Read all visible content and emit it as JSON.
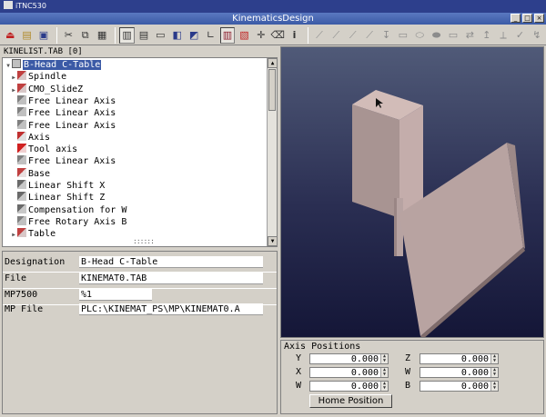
{
  "os_bar": {
    "title": "iTNC530"
  },
  "window": {
    "title": "KinematicsDesign"
  },
  "tree": {
    "header": "KINELIST.TAB   [0]",
    "items": [
      {
        "label": "B-Head C-Table",
        "expand": "▼",
        "icon": "table-root-icon",
        "selected": true
      },
      {
        "label": "Spindle",
        "expand": "▶",
        "icon": "component-icon"
      },
      {
        "label": "CMO_SlideZ",
        "expand": "▶",
        "icon": "component-icon"
      },
      {
        "label": "Free Linear Axis",
        "expand": "",
        "icon": "linear-axis-icon"
      },
      {
        "label": "Free Linear Axis",
        "expand": "",
        "icon": "linear-axis-icon"
      },
      {
        "label": "Free Linear Axis",
        "expand": "",
        "icon": "linear-axis-icon"
      },
      {
        "label": "Axis",
        "expand": "",
        "icon": "axis-icon"
      },
      {
        "label": "Tool axis",
        "expand": "",
        "icon": "tool-axis-icon"
      },
      {
        "label": "Free Linear Axis",
        "expand": "",
        "icon": "linear-axis-icon"
      },
      {
        "label": "Base",
        "expand": "",
        "icon": "base-icon"
      },
      {
        "label": "Linear Shift X",
        "expand": "",
        "icon": "shift-icon"
      },
      {
        "label": "Linear Shift Z",
        "expand": "",
        "icon": "shift-icon"
      },
      {
        "label": "Compensation for W",
        "expand": "",
        "icon": "shift-icon"
      },
      {
        "label": "Free Rotary Axis B",
        "expand": "",
        "icon": "linear-axis-icon"
      },
      {
        "label": "Table",
        "expand": "▶",
        "icon": "component-icon"
      },
      {
        "label": "",
        "expand": "",
        "icon": "arrow-icon"
      }
    ]
  },
  "properties": {
    "designation_label": "Designation",
    "designation_value": "B-Head C-Table",
    "file_label": "File",
    "file_value": "KINEMAT0.TAB",
    "mp7500_label": "MP7500",
    "mp7500_value": "%1",
    "mpfile_label": "MP File",
    "mpfile_value": "PLC:\\KINEMAT_PS\\MP\\KINEMAT0.A"
  },
  "axis_positions": {
    "title": "Axis Positions",
    "axes": [
      {
        "name": "Y",
        "value": "0.000"
      },
      {
        "name": "Z",
        "value": "0.000"
      },
      {
        "name": "X",
        "value": "0.000"
      },
      {
        "name": "W",
        "value": "0.000"
      },
      {
        "name": "W",
        "value": "0.000"
      },
      {
        "name": "B",
        "value": "0.000"
      }
    ],
    "home_button": "Home Position"
  }
}
